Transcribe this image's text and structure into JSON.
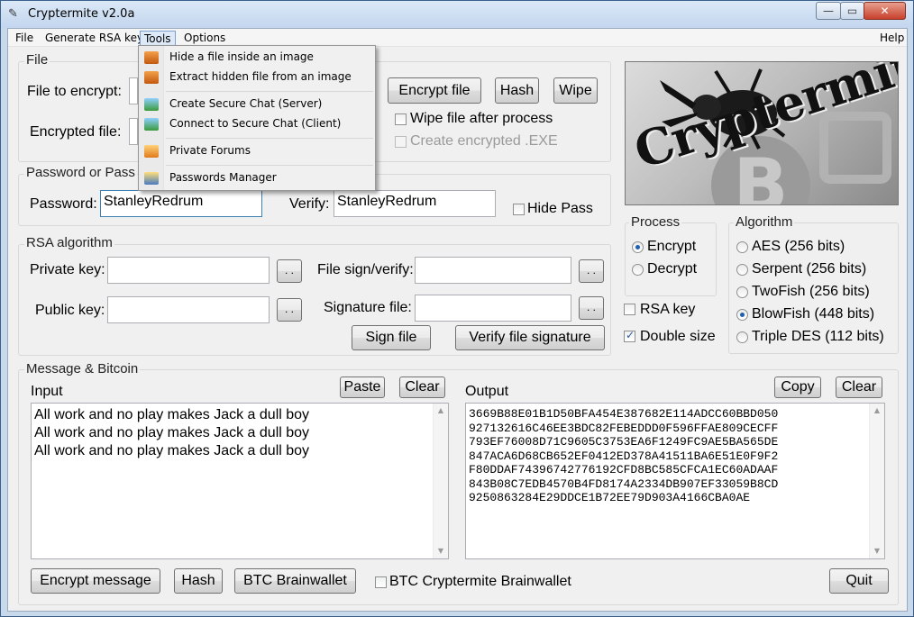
{
  "window": {
    "title": "Cryptermite v2.0a",
    "min": "—",
    "max": "▭",
    "close": "✕"
  },
  "menubar": {
    "file": "File",
    "rsa": "Generate RSA keys",
    "tools": "Tools",
    "options": "Options",
    "help": "Help"
  },
  "tools_menu": {
    "hide_file": "Hide a file inside an image",
    "extract_file": "Extract hidden file from an image",
    "chat_server": "Create Secure Chat (Server)",
    "chat_client": "Connect to Secure Chat (Client)",
    "forums": "Private Forums",
    "passwords": "Passwords Manager"
  },
  "file_group": {
    "title": "File",
    "file_to_encrypt_label": "File to encrypt:",
    "encrypted_file_label": "Encrypted file:",
    "encrypt_file_btn": "Encrypt file",
    "hash_btn": "Hash",
    "wipe_btn": "Wipe",
    "wipe_after_label": "Wipe file after process",
    "create_exe_label": "Create encrypted .EXE"
  },
  "password_group": {
    "title": "Password or Pass",
    "password_label": "Password:",
    "password_value": "StanleyRedrum",
    "verify_label": "Verify:",
    "verify_value": "StanleyRedrum",
    "hide_pass_label": "Hide Pass"
  },
  "rsa_group": {
    "title": "RSA algorithm",
    "private_key_label": "Private key:",
    "public_key_label": "Public key:",
    "file_sign_label": "File sign/verify:",
    "signature_file_label": "Signature file:",
    "browse": ". .",
    "sign_file_btn": "Sign file",
    "verify_sig_btn": "Verify file signature"
  },
  "process_group": {
    "title": "Process",
    "encrypt": "Encrypt",
    "decrypt": "Decrypt",
    "selected": "Encrypt"
  },
  "options": {
    "rsa_key": "RSA key",
    "double_size": "Double size"
  },
  "algorithm_group": {
    "title": "Algorithm",
    "aes": "AES (256 bits)",
    "serpent": "Serpent (256 bits)",
    "twofish": "TwoFish (256 bits)",
    "blowfish": "BlowFish (448 bits)",
    "tripledes": "Triple DES (112 bits)",
    "selected": "BlowFish (448 bits)"
  },
  "logo": {
    "brand": "Cryptermite",
    "coin": "B"
  },
  "message_group": {
    "title": "Message & Bitcoin",
    "input_label": "Input",
    "output_label": "Output",
    "paste_btn": "Paste",
    "clear_btn": "Clear",
    "copy_btn": "Copy",
    "clear_out_btn": "Clear",
    "input_lines": [
      "All work and no play makes Jack a dull boy",
      "All work and no play makes Jack a dull boy",
      "All work and no play makes Jack a dull boy"
    ],
    "output_lines": [
      "3669B88E01B1D50BFA454E387682E114ADCC60BBD050",
      "927132616C46EE3BDC82FEBEDDD0F596FFAE809CECFF",
      "793EF76008D71C9605C3753EA6F1249FC9AE5BA565DE",
      "847ACA6D68CB652EF0412ED378A41511BA6E51E0F9F2",
      "F80DDAF74396742776192CFD8BC585CFCA1EC60ADAAF",
      "843B08C7EDB4570B4FD8174A2334DB907EF33059B8CD",
      "9250863284E29DDCE1B72EE79D903A4166CBA0AE"
    ],
    "encrypt_msg_btn": "Encrypt message",
    "hash_btn": "Hash",
    "brainwallet_btn": "BTC Brainwallet",
    "crypt_brainwallet_label": "BTC Cryptermite Brainwallet",
    "quit_btn": "Quit"
  }
}
